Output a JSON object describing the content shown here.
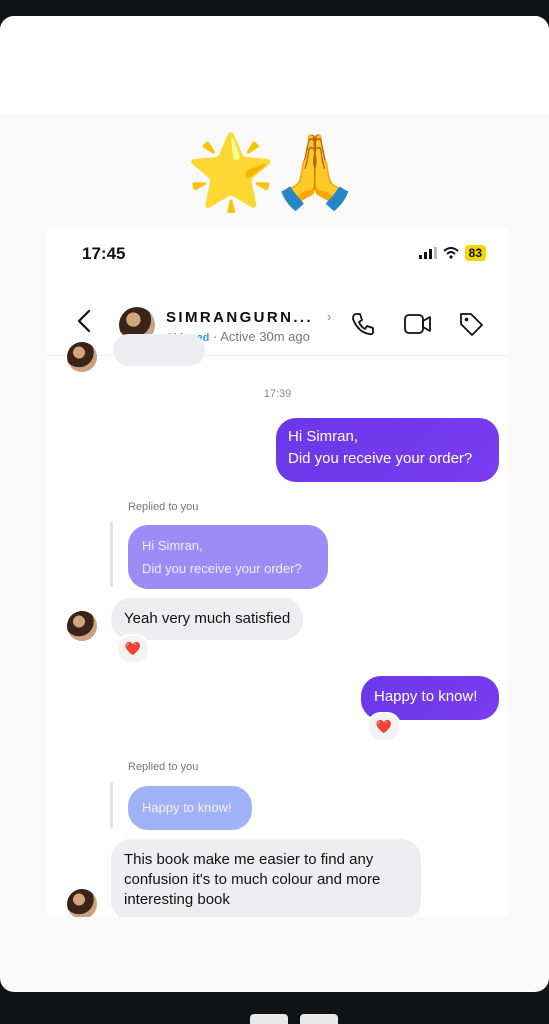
{
  "emojis": {
    "star": "🌟",
    "pray": "🙏"
  },
  "status_bar": {
    "time": "17:45",
    "battery": "83"
  },
  "header": {
    "username": "SIMRANGURN...",
    "shipped_tag": "Shipped",
    "active_status": "· Active 30m ago"
  },
  "messages": {
    "timestamp": "17:39",
    "sent_1": {
      "line1": "Hi Simran,",
      "line2": "Did you receive your order?"
    },
    "replied_label_1": "Replied to you",
    "quote_1": {
      "line1": "Hi Simran,",
      "line2": "Did you receive your order?"
    },
    "received_1": "Yeah very much satisfied",
    "reaction_1": "❤️",
    "sent_2": "Happy to know!",
    "reaction_2": "❤️",
    "replied_label_2": "Replied to you",
    "quote_2": "Happy to know!",
    "received_2": "This book make me easier to find any confusion it's to much colour and more interesting book"
  },
  "colors": {
    "accent": "#7a3cf0",
    "shipped": "#2aa0d8",
    "battery": "#f5d400"
  }
}
